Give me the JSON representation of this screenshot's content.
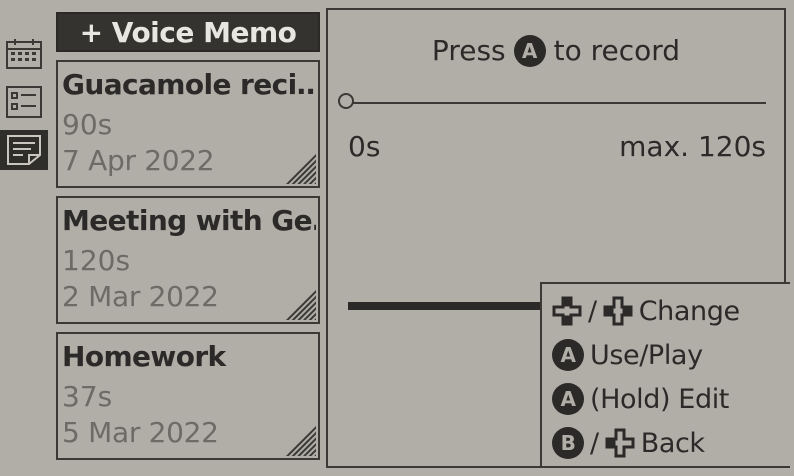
{
  "rail": {
    "icons": [
      "calendar-icon",
      "checklist-icon",
      "memo-note-icon"
    ],
    "active_index": 2
  },
  "list": {
    "new_memo_label": "+ Voice Memo",
    "memos": [
      {
        "title": "Guacamole reci…",
        "duration": "90s",
        "date": "7 Apr 2022"
      },
      {
        "title": "Meeting with Ge…",
        "duration": "120s",
        "date": "2 Mar 2022"
      },
      {
        "title": "Homework",
        "duration": "37s",
        "date": "5 Mar 2022"
      }
    ]
  },
  "recorder": {
    "prompt_before": "Press",
    "prompt_button": "A",
    "prompt_after": "to record",
    "time_start": "0s",
    "time_max": "max. 120s",
    "progress": 0
  },
  "legend": {
    "rows": [
      {
        "glyph_a": "dpad",
        "glyph_b": "dpad",
        "text": "Change"
      },
      {
        "glyph_a": "A",
        "text": "Use/Play"
      },
      {
        "glyph_a": "A",
        "text": "(Hold) Edit"
      },
      {
        "glyph_a": "B",
        "glyph_b": "dpad",
        "text": "Back"
      }
    ]
  },
  "colors": {
    "background": "#b1aea8",
    "ink": "#2b2a28",
    "muted": "#6d6b66",
    "header_fill": "#34332f"
  }
}
